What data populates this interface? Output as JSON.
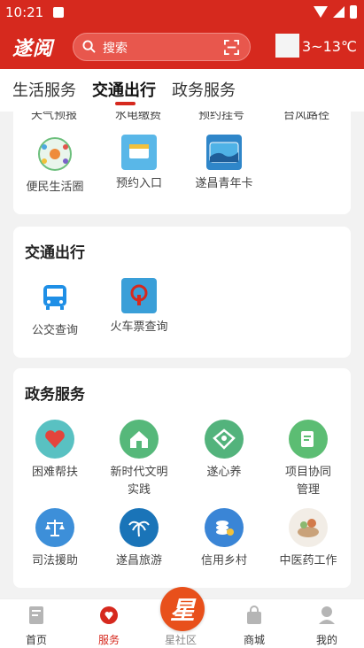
{
  "status": {
    "time": "10:21"
  },
  "header": {
    "logo": "遂阅",
    "search_placeholder": "搜索",
    "temp": "3~13℃"
  },
  "tabs": [
    {
      "label": "生活服务"
    },
    {
      "label": "交通出行"
    },
    {
      "label": "政务服务"
    }
  ],
  "cut_row": [
    "天气预报",
    "水电缴费",
    "预约挂号",
    "台风路径"
  ],
  "life": {
    "items": [
      {
        "label": "便民生活圈",
        "icon": "community-map-icon"
      },
      {
        "label": "预约入口",
        "icon": "booking-entry-icon"
      },
      {
        "label": "遂昌青年卡",
        "icon": "youth-card-icon"
      }
    ]
  },
  "traffic": {
    "title": "交通出行",
    "items": [
      {
        "label": "公交查询",
        "icon": "bus-icon"
      },
      {
        "label": "火车票查询",
        "icon": "train-ticket-icon"
      }
    ]
  },
  "gov": {
    "title": "政务服务",
    "items": [
      {
        "label": "困难帮扶",
        "icon": "heart-hand-icon"
      },
      {
        "label": "新时代文明实践",
        "icon": "building-icon"
      },
      {
        "label": "遂心养",
        "icon": "home-care-icon"
      },
      {
        "label": "项目协同管理",
        "icon": "document-edit-icon"
      },
      {
        "label": "司法援助",
        "icon": "scales-icon"
      },
      {
        "label": "遂昌旅游",
        "icon": "palm-tree-icon"
      },
      {
        "label": "信用乡村",
        "icon": "coins-star-icon"
      },
      {
        "label": "中医药工作",
        "icon": "herbal-medicine-icon"
      }
    ]
  },
  "nav": [
    {
      "label": "首页"
    },
    {
      "label": "服务"
    },
    {
      "label": "星社区",
      "badge": "星"
    },
    {
      "label": "商城"
    },
    {
      "label": "我的"
    }
  ],
  "colors": {
    "brand": "#d6291e",
    "star": "#e8501b"
  }
}
